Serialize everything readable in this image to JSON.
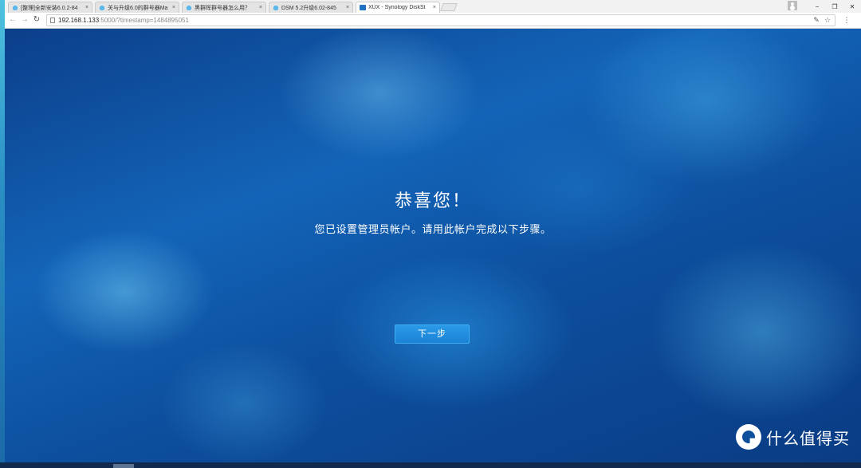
{
  "browser": {
    "tabs": [
      {
        "label": "[整理]全新安装6.0.2-84",
        "favicon": "cloud-icon",
        "active": false
      },
      {
        "label": "关与升级6.0的群号器Ma",
        "favicon": "cloud-icon",
        "active": false
      },
      {
        "label": "黑群晖群号器怎么用？",
        "favicon": "cloud-icon",
        "active": false
      },
      {
        "label": "DSM 5.2升级6.02-845",
        "favicon": "cloud-icon",
        "active": false
      },
      {
        "label": "XUX - Synology DiskSt",
        "favicon": "dsm-icon",
        "active": true
      }
    ],
    "tab_close": "×",
    "window_controls": {
      "minimize": "−",
      "maximize": "❐",
      "close": "✕"
    },
    "address": {
      "host": "192.168.1.133",
      "path": ":5000/?timestamp=1484895051"
    }
  },
  "page": {
    "title": "恭喜您！",
    "subtitle": "您已设置管理员帐户。请用此帐户完成以下步骤。",
    "next_button": "下一步"
  },
  "watermark": {
    "text": "什么值得买"
  }
}
